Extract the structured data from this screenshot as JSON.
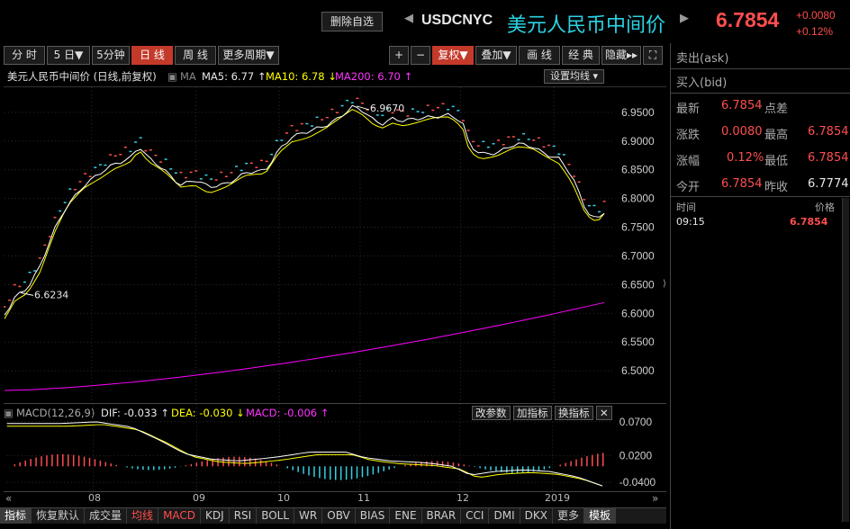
{
  "header": {
    "delete_label": "删除自选",
    "symbol": "USDCNYC",
    "name": "美元人民币中间价",
    "price": "6.7854",
    "change": "+0.0080",
    "change_pct": "+0.12%"
  },
  "toolbar": {
    "periods": [
      "分 时",
      "5 日▼",
      "5分钟",
      "日 线",
      "周 线",
      "更多周期▼"
    ],
    "active_period": "日 线",
    "right_buttons": [
      "+",
      "−",
      "复权▼",
      "叠加▼",
      "画 线",
      "经 典",
      "隐藏▸▸"
    ]
  },
  "legend": {
    "title": "美元人民币中间价 (日线,前复权)",
    "ma_label": "MA",
    "ma5": "MA5: 6.77 ↑",
    "ma10": "MA10: 6.78 ↓",
    "ma200": "MA200: 6.70 ↑",
    "settings": "设置均线"
  },
  "price_axis": [
    "6.9500",
    "6.9000",
    "6.8500",
    "6.8000",
    "6.7500",
    "6.7000",
    "6.6500",
    "6.6000",
    "6.5500",
    "6.5000"
  ],
  "annotations": {
    "high": "6.9670",
    "low": "6.6234"
  },
  "macd_legend": {
    "title": "MACD(12,26,9)",
    "dif": "DIF: -0.033 ↑",
    "dea": "DEA: -0.030 ↓",
    "macd": "MACD: -0.006 ↑",
    "buttons": [
      "改参数",
      "加指标",
      "换指标",
      "✕"
    ]
  },
  "macd_axis": [
    "0.0700",
    "0.0200",
    "-0.0400"
  ],
  "x_labels": [
    "08",
    "09",
    "10",
    "11",
    "12",
    "2019"
  ],
  "bottom_tabs": [
    "指标",
    "恢复默认",
    "成交量",
    "均线",
    "MACD",
    "KDJ",
    "RSI",
    "BOLL",
    "WR",
    "OBV",
    "BIAS",
    "ENE",
    "BRAR",
    "CCI",
    "DMI",
    "DKX",
    "更多",
    "模板"
  ],
  "quote": {
    "ask_label": "卖出(ask)",
    "bid_label": "买入(bid)",
    "latest_label": "最新",
    "latest": "6.7854",
    "points_label": "点差",
    "points": "",
    "change_label": "涨跌",
    "change": "0.0080",
    "high_label": "最高",
    "high": "6.7854",
    "pct_label": "涨幅",
    "pct": "0.12%",
    "low_label": "最低",
    "low": "6.7854",
    "open_label": "今开",
    "open": "6.7854",
    "prev_label": "昨收",
    "prev": "6.7774"
  },
  "ticks": {
    "time_label": "时间",
    "price_label": "价格",
    "rows": [
      {
        "time": "09:15",
        "price": "6.7854"
      }
    ]
  },
  "colors": {
    "accent": "#c43a2a",
    "up": "#ff4e4e",
    "ma5": "#ffffff",
    "ma10": "#ffff00",
    "ma200": "#ff00ff",
    "name": "#2bd3e3"
  }
}
